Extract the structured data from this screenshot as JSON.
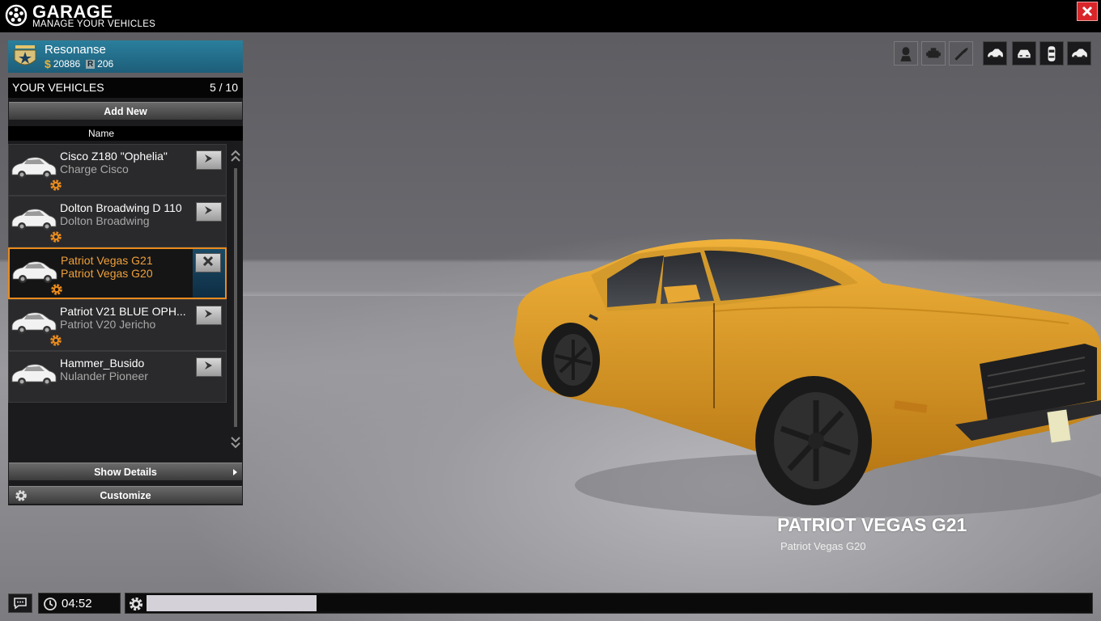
{
  "header": {
    "title": "GARAGE",
    "subtitle": "MANAGE YOUR VEHICLES"
  },
  "profile": {
    "name": "Resonanse",
    "cash": "20886",
    "rep": "206"
  },
  "vehicles_panel": {
    "title": "YOUR VEHICLES",
    "count": "5 / 10",
    "add_label": "Add New",
    "column_name": "Name",
    "items": [
      {
        "name": "Cisco Z180 \"Ophelia\"",
        "model": "Charge Cisco",
        "has_gear": true
      },
      {
        "name": "Dolton Broadwing D 110",
        "model": "Dolton Broadwing",
        "has_gear": true
      },
      {
        "name": "Patriot Vegas G21",
        "model": "Patriot Vegas G20",
        "has_gear": true,
        "selected": true
      },
      {
        "name": "Patriot V21 BLUE OPH...",
        "model": "Patriot V20 Jericho",
        "has_gear": true
      },
      {
        "name": "Hammer_Busido",
        "model": "Nulander Pioneer",
        "has_gear": false
      }
    ],
    "details_label": "Show Details",
    "customize_label": "Customize"
  },
  "toolbar": {
    "icons": [
      "driver-icon",
      "engine-icon",
      "horn-icon",
      "car-side-icon",
      "car-front-icon",
      "car-top-icon",
      "car-rear-icon"
    ]
  },
  "showcase": {
    "title": "PATRIOT VEGAS G21",
    "subtitle": "Patriot Vegas G20"
  },
  "bottom": {
    "time": "04:52",
    "progress": 0.18
  },
  "colors": {
    "accent": "#e88a1d",
    "profile_blue": "#1d5e7a",
    "close_red": "#d8262a",
    "car_yellow": "#e3a12c"
  }
}
